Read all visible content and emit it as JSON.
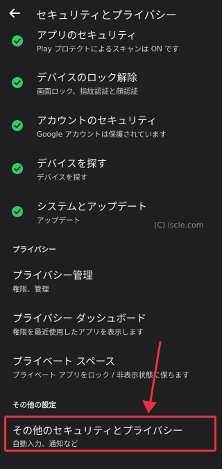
{
  "header": {
    "title": "セキュリティとプライバシー"
  },
  "security_items": [
    {
      "title": "アプリのセキュリティ",
      "subtitle": "Play プロテクトによるスキャンは ON です",
      "status": "ok"
    },
    {
      "title": "デバイスのロック解除",
      "subtitle": "画面ロック、指紋認証と顔認証",
      "status": "ok"
    },
    {
      "title": "アカウントのセキュリティ",
      "subtitle": "Google アカウントは保護されています",
      "status": "ok"
    },
    {
      "title": "デバイスを探す",
      "subtitle": "デバイスを探す",
      "status": "ok"
    },
    {
      "title": "システムとアップデート",
      "subtitle": "アップデート",
      "status": "ok"
    }
  ],
  "watermark": "(C) iscle.com",
  "privacy_section": {
    "heading": "プライバシー",
    "items": [
      {
        "title": "プライバシー管理",
        "subtitle": "権限、管理"
      },
      {
        "title": "プライバシー ダッシュボード",
        "subtitle": "権限を最近使用したアプリを表示します"
      },
      {
        "title": "プライベート スペース",
        "subtitle": "プライベート アプリをロック / 非表示状態に保ちます"
      }
    ]
  },
  "other_section": {
    "heading": "その他の設定",
    "items": [
      {
        "title": "その他のセキュリティとプライバシー",
        "subtitle": "自動入力、通知など"
      }
    ]
  },
  "colors": {
    "background": "#1f1f1f",
    "check_green": "#37c76a",
    "highlight_red": "#e8323f"
  }
}
